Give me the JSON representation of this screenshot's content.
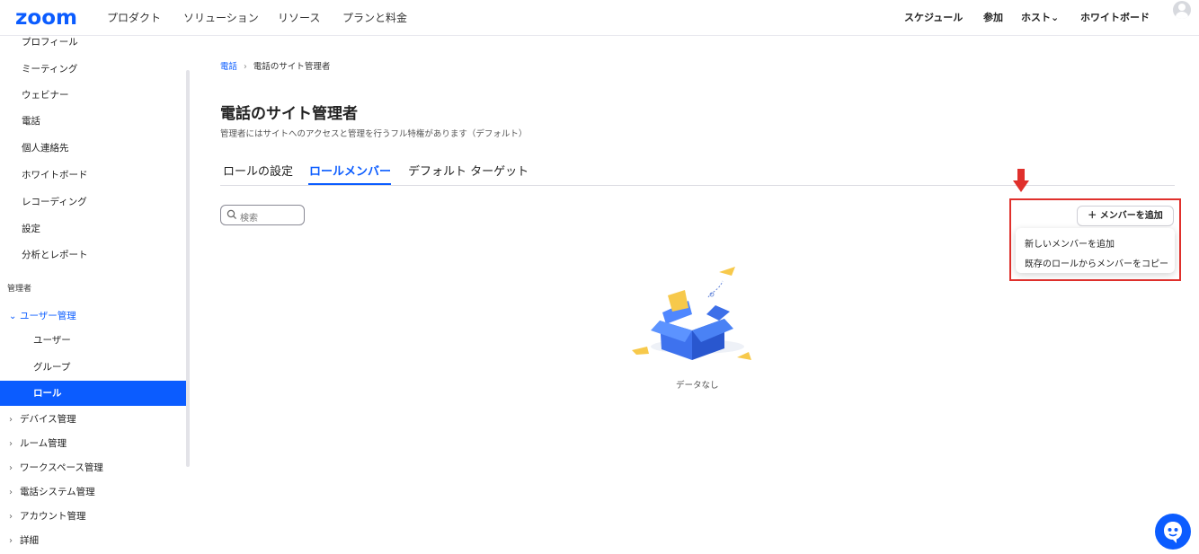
{
  "topbar": {
    "logo": "zoom",
    "nav": [
      "プロダクト",
      "ソリューション",
      "リソース",
      "プランと料金"
    ],
    "right": [
      "スケジュール",
      "参加",
      "ホスト⌄",
      "ホワイトボード"
    ]
  },
  "sidebar": {
    "items_top": [
      "プロフィール",
      "ミーティング",
      "ウェビナー",
      "電話",
      "個人連絡先",
      "ホワイトボード",
      "レコーディング",
      "設定",
      "分析とレポート"
    ],
    "admin_section": "管理者",
    "user_mgmt": "ユーザー管理",
    "user_mgmt_children": [
      "ユーザー",
      "グループ",
      "ロール"
    ],
    "collapsed": [
      "デバイス管理",
      "ルーム管理",
      "ワークスペース管理",
      "電話システム管理",
      "アカウント管理",
      "詳細"
    ]
  },
  "breadcrumb": {
    "link": "電話",
    "sep": "›",
    "current": "電話のサイト管理者"
  },
  "page": {
    "title": "電話のサイト管理者",
    "subtitle": "管理者にはサイトへのアクセスと管理を行うフル特権があります（デフォルト）"
  },
  "tabs": [
    "ロールの設定",
    "ロールメンバー",
    "デフォルト ターゲット"
  ],
  "search": {
    "placeholder": "検索"
  },
  "add_member": {
    "label": "＋ メンバーを追加"
  },
  "menu": [
    "新しいメンバーを追加",
    "既存のロールからメンバーをコピー"
  ],
  "empty": {
    "text": "データなし"
  },
  "colors": {
    "brand": "#0b5cff",
    "highlight": "#e0302c"
  }
}
